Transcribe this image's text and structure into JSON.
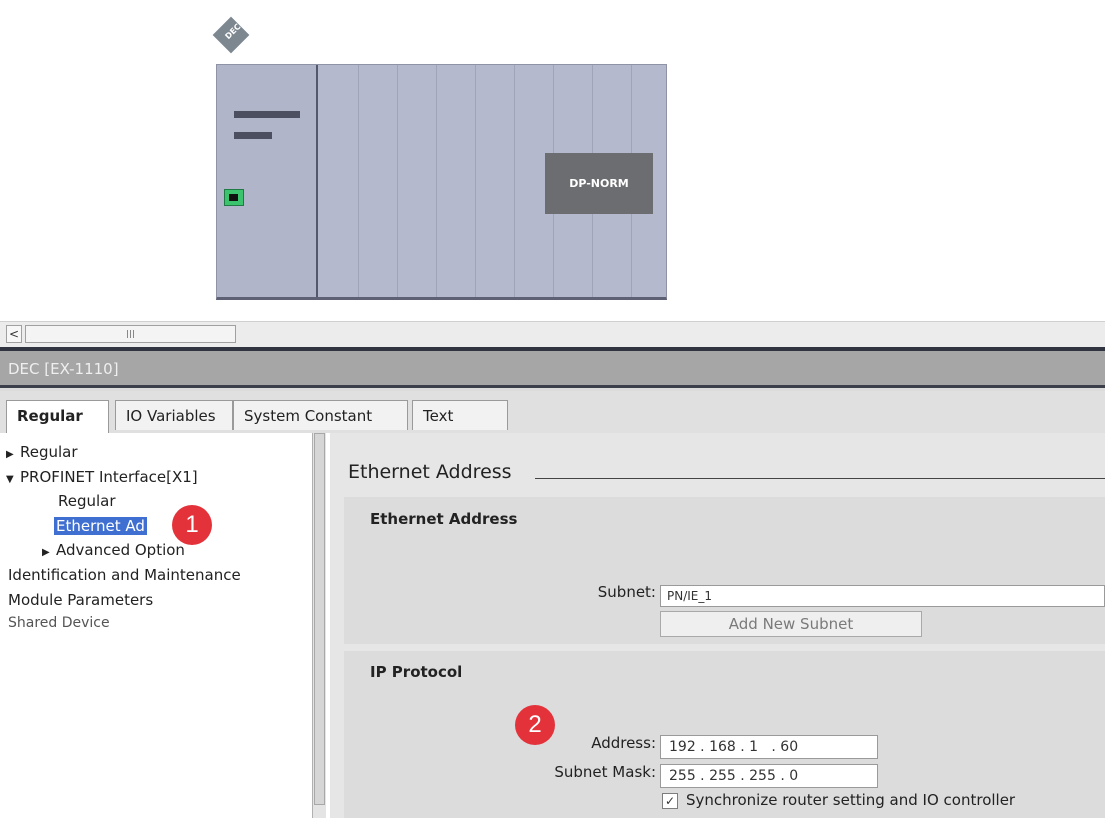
{
  "canvas": {
    "device_tag": "DEC",
    "module_label": "DP-NORM"
  },
  "scrollbar": {
    "left_arrow": "<"
  },
  "panel": {
    "title": "DEC [EX-1110]",
    "tabs": [
      {
        "label": "Regular",
        "active": true
      },
      {
        "label": "IO Variables",
        "active": false
      },
      {
        "label": "System Constant",
        "active": false
      },
      {
        "label": "Text",
        "active": false
      }
    ]
  },
  "tree": {
    "items": [
      {
        "label": "Regular",
        "arrow": "▶"
      },
      {
        "label": "PROFINET Interface[X1]",
        "arrow": "▼"
      },
      {
        "label": "Regular"
      },
      {
        "label": "Ethernet Ad",
        "selected": true
      },
      {
        "label": "Advanced Option",
        "arrow": "▶"
      },
      {
        "label": "Identification and Maintenance"
      },
      {
        "label": "Module Parameters"
      },
      {
        "label": "Shared Device"
      }
    ]
  },
  "content": {
    "section_title": "Ethernet Address",
    "ethernet_group": {
      "title": "Ethernet Address",
      "subnet_label": "Subnet:",
      "subnet_value": "PN/IE_1",
      "add_subnet_button": "Add New Subnet"
    },
    "ip_group": {
      "title": "IP Protocol",
      "address_label": "Address:",
      "address_value": "192 . 168 . 1   . 60",
      "subnet_mask_label": "Subnet Mask:",
      "subnet_mask_value": "255 . 255 . 255 . 0",
      "sync_checked": true,
      "sync_label": "Synchronize router setting and IO controller"
    }
  },
  "callouts": [
    "1",
    "2"
  ],
  "colors": {
    "callout": "#e3323a",
    "selection": "#3e6fd1",
    "port_green": "#3cc36e"
  }
}
